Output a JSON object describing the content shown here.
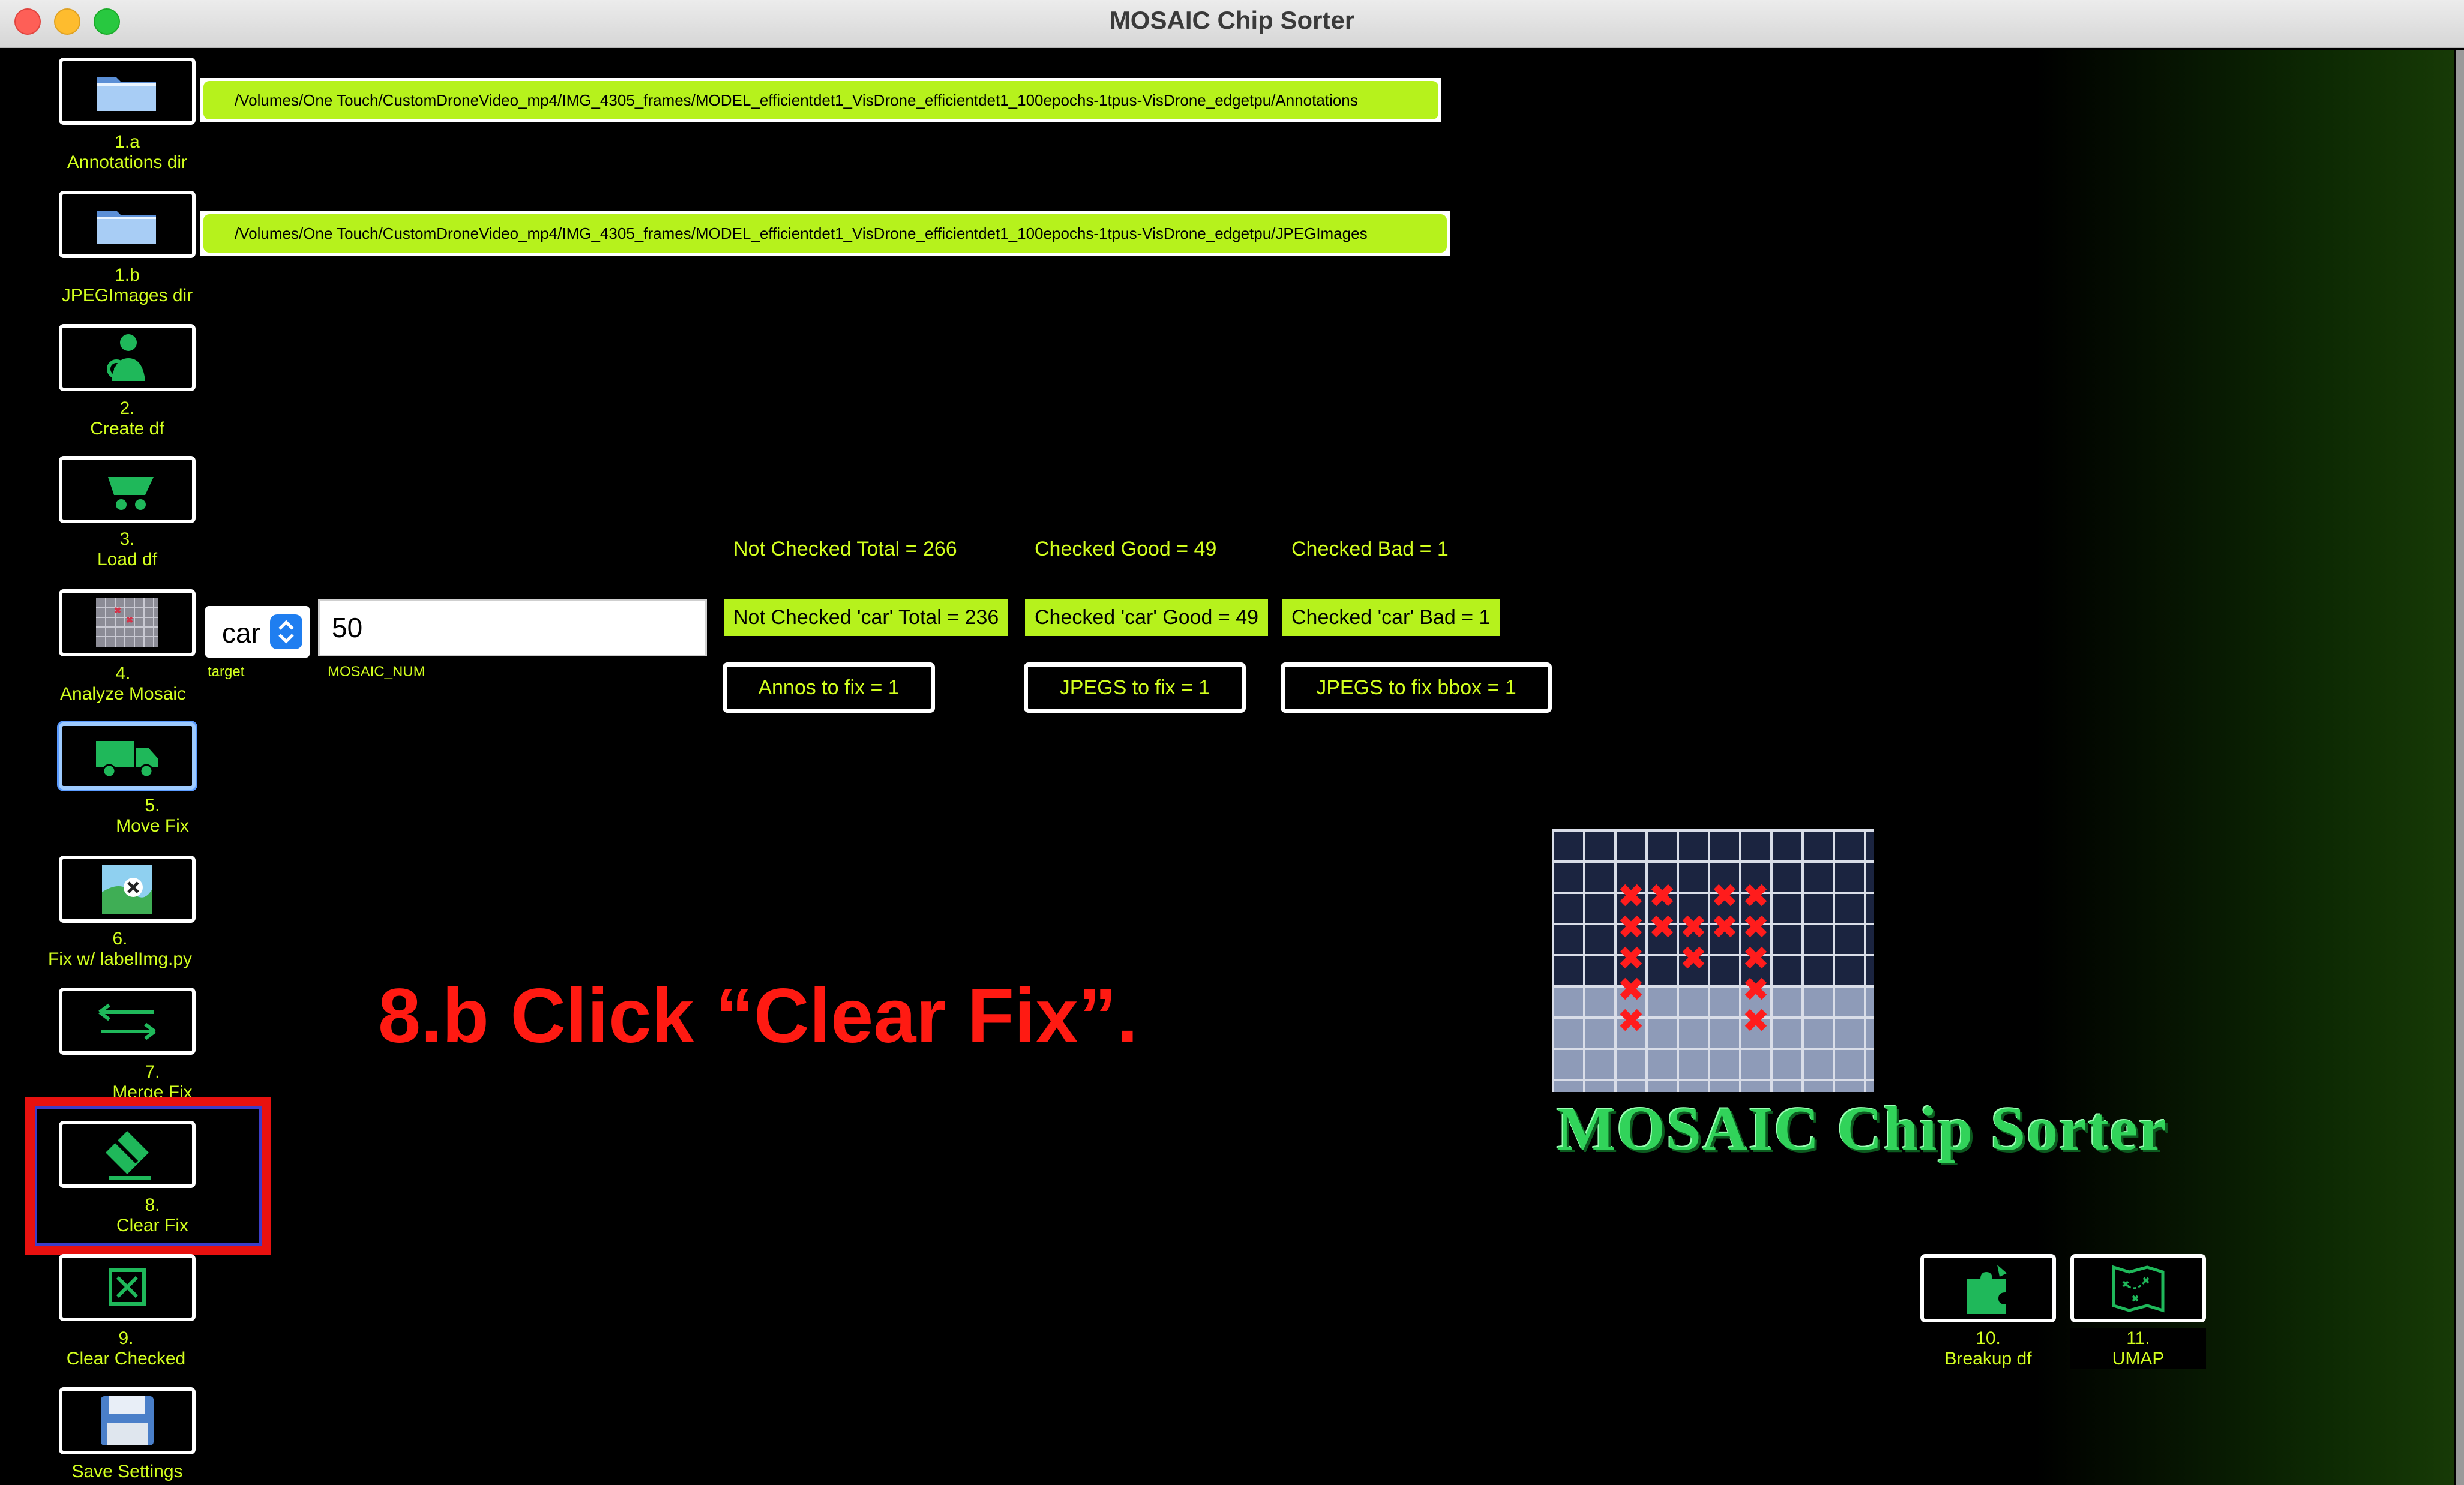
{
  "window": {
    "title": "MOSAIC Chip Sorter"
  },
  "paths": {
    "annotations": "/Volumes/One Touch/CustomDroneVideo_mp4/IMG_4305_frames/MODEL_efficientdet1_VisDrone_efficientdet1_100epochs-1tpus-VisDrone_edgetpu/Annotations",
    "jpegimages": "/Volumes/One Touch/CustomDroneVideo_mp4/IMG_4305_frames/MODEL_efficientdet1_VisDrone_efficientdet1_100epochs-1tpus-VisDrone_edgetpu/JPEGImages"
  },
  "tools": [
    {
      "num": "1.a",
      "label": "Annotations dir",
      "icon": "folder-icon"
    },
    {
      "num": "1.b",
      "label": "JPEGImages dir",
      "icon": "folder-icon"
    },
    {
      "num": "2.",
      "label": "Create df",
      "icon": "person-gear-icon"
    },
    {
      "num": "3.",
      "label": "Load df",
      "icon": "wheelbarrow-icon"
    },
    {
      "num": "4.",
      "label": "Analyze Mosaic",
      "icon": "mosaic-thumbnail-icon"
    },
    {
      "num": "5.",
      "label": "Move Fix",
      "icon": "truck-icon"
    },
    {
      "num": "6.",
      "label": "Fix w/ labelImg.py",
      "icon": "map-edit-icon"
    },
    {
      "num": "7.",
      "label": "Merge Fix",
      "icon": "swap-arrows-icon"
    },
    {
      "num": "8.",
      "label": "Clear Fix",
      "icon": "eraser-icon"
    },
    {
      "num": "9.",
      "label": "Clear Checked",
      "icon": "x-box-icon"
    },
    {
      "num": "",
      "label": "Save Settings",
      "icon": "floppy-disk-icon"
    }
  ],
  "target": {
    "value": "car",
    "label": "target"
  },
  "mosaic_num": {
    "value": "50",
    "label": "MOSAIC_NUM"
  },
  "stats": {
    "not_checked_total": "Not Checked Total = 266",
    "checked_good": "Checked Good = 49",
    "checked_bad": "Checked Bad = 1",
    "not_checked_car": "Not Checked 'car' Total = 236",
    "checked_car_good": "Checked 'car' Good = 49",
    "checked_car_bad": "Checked 'car' Bad = 1"
  },
  "fix_buttons": {
    "annos": "Annos to fix = 1",
    "jpegs": "JPEGS to fix = 1",
    "jpegs_bbox": "JPEGS to fix bbox = 1"
  },
  "annotation": "8.b  Click “Clear Fix”.",
  "logo": {
    "text": "MOSAIC Chip Sorter"
  },
  "right_tools": [
    {
      "num": "10.",
      "label": "Breakup df",
      "icon": "puzzle-icon"
    },
    {
      "num": "11.",
      "label": "UMAP",
      "icon": "map-plot-icon"
    }
  ],
  "colors": {
    "accent": "#d2ff1e",
    "field": "#b6f21c",
    "icon": "#1fb85a",
    "annotation": "#ff1a12"
  }
}
